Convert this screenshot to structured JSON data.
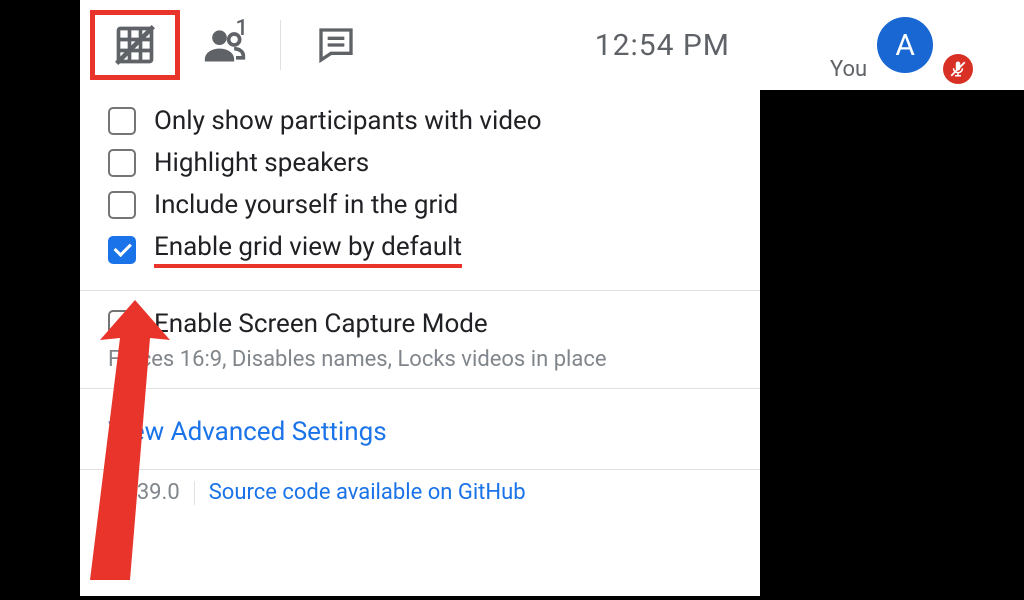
{
  "toolbar": {
    "people_count": "1",
    "clock": "12:54 PM"
  },
  "options": {
    "item1": "Only show participants with video",
    "item2": "Highlight speakers",
    "item3": "Include yourself in the grid",
    "item4": "Enable grid view by default",
    "capture_label": "Enable Screen Capture Mode",
    "capture_desc": "Forces 16:9, Disables names, Locks videos in place"
  },
  "links": {
    "advanced": "View Advanced Settings",
    "github": "Source code available on GitHub"
  },
  "version": "v1.39.0",
  "selfview": {
    "you": "You",
    "initial": "A"
  }
}
